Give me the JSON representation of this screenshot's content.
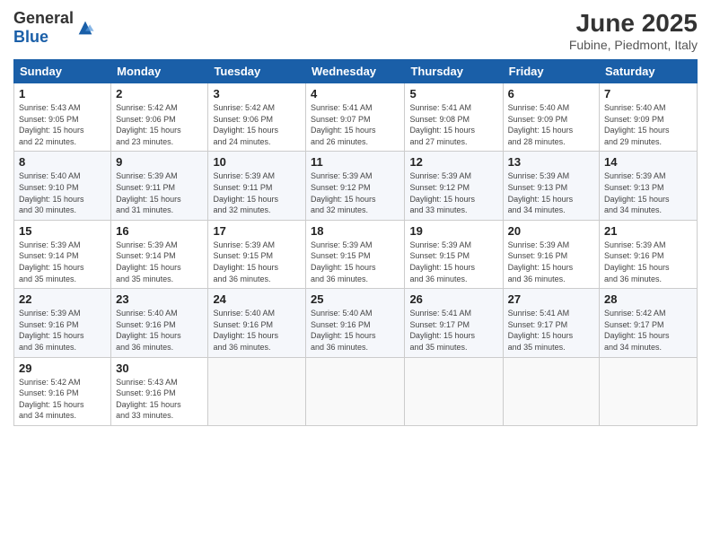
{
  "header": {
    "logo_general": "General",
    "logo_blue": "Blue",
    "month": "June 2025",
    "location": "Fubine, Piedmont, Italy"
  },
  "weekdays": [
    "Sunday",
    "Monday",
    "Tuesday",
    "Wednesday",
    "Thursday",
    "Friday",
    "Saturday"
  ],
  "weeks": [
    [
      {
        "day": "1",
        "info": "Sunrise: 5:43 AM\nSunset: 9:05 PM\nDaylight: 15 hours\nand 22 minutes."
      },
      {
        "day": "2",
        "info": "Sunrise: 5:42 AM\nSunset: 9:06 PM\nDaylight: 15 hours\nand 23 minutes."
      },
      {
        "day": "3",
        "info": "Sunrise: 5:42 AM\nSunset: 9:06 PM\nDaylight: 15 hours\nand 24 minutes."
      },
      {
        "day": "4",
        "info": "Sunrise: 5:41 AM\nSunset: 9:07 PM\nDaylight: 15 hours\nand 26 minutes."
      },
      {
        "day": "5",
        "info": "Sunrise: 5:41 AM\nSunset: 9:08 PM\nDaylight: 15 hours\nand 27 minutes."
      },
      {
        "day": "6",
        "info": "Sunrise: 5:40 AM\nSunset: 9:09 PM\nDaylight: 15 hours\nand 28 minutes."
      },
      {
        "day": "7",
        "info": "Sunrise: 5:40 AM\nSunset: 9:09 PM\nDaylight: 15 hours\nand 29 minutes."
      }
    ],
    [
      {
        "day": "8",
        "info": "Sunrise: 5:40 AM\nSunset: 9:10 PM\nDaylight: 15 hours\nand 30 minutes."
      },
      {
        "day": "9",
        "info": "Sunrise: 5:39 AM\nSunset: 9:11 PM\nDaylight: 15 hours\nand 31 minutes."
      },
      {
        "day": "10",
        "info": "Sunrise: 5:39 AM\nSunset: 9:11 PM\nDaylight: 15 hours\nand 32 minutes."
      },
      {
        "day": "11",
        "info": "Sunrise: 5:39 AM\nSunset: 9:12 PM\nDaylight: 15 hours\nand 32 minutes."
      },
      {
        "day": "12",
        "info": "Sunrise: 5:39 AM\nSunset: 9:12 PM\nDaylight: 15 hours\nand 33 minutes."
      },
      {
        "day": "13",
        "info": "Sunrise: 5:39 AM\nSunset: 9:13 PM\nDaylight: 15 hours\nand 34 minutes."
      },
      {
        "day": "14",
        "info": "Sunrise: 5:39 AM\nSunset: 9:13 PM\nDaylight: 15 hours\nand 34 minutes."
      }
    ],
    [
      {
        "day": "15",
        "info": "Sunrise: 5:39 AM\nSunset: 9:14 PM\nDaylight: 15 hours\nand 35 minutes."
      },
      {
        "day": "16",
        "info": "Sunrise: 5:39 AM\nSunset: 9:14 PM\nDaylight: 15 hours\nand 35 minutes."
      },
      {
        "day": "17",
        "info": "Sunrise: 5:39 AM\nSunset: 9:15 PM\nDaylight: 15 hours\nand 36 minutes."
      },
      {
        "day": "18",
        "info": "Sunrise: 5:39 AM\nSunset: 9:15 PM\nDaylight: 15 hours\nand 36 minutes."
      },
      {
        "day": "19",
        "info": "Sunrise: 5:39 AM\nSunset: 9:15 PM\nDaylight: 15 hours\nand 36 minutes."
      },
      {
        "day": "20",
        "info": "Sunrise: 5:39 AM\nSunset: 9:16 PM\nDaylight: 15 hours\nand 36 minutes."
      },
      {
        "day": "21",
        "info": "Sunrise: 5:39 AM\nSunset: 9:16 PM\nDaylight: 15 hours\nand 36 minutes."
      }
    ],
    [
      {
        "day": "22",
        "info": "Sunrise: 5:39 AM\nSunset: 9:16 PM\nDaylight: 15 hours\nand 36 minutes."
      },
      {
        "day": "23",
        "info": "Sunrise: 5:40 AM\nSunset: 9:16 PM\nDaylight: 15 hours\nand 36 minutes."
      },
      {
        "day": "24",
        "info": "Sunrise: 5:40 AM\nSunset: 9:16 PM\nDaylight: 15 hours\nand 36 minutes."
      },
      {
        "day": "25",
        "info": "Sunrise: 5:40 AM\nSunset: 9:16 PM\nDaylight: 15 hours\nand 36 minutes."
      },
      {
        "day": "26",
        "info": "Sunrise: 5:41 AM\nSunset: 9:17 PM\nDaylight: 15 hours\nand 35 minutes."
      },
      {
        "day": "27",
        "info": "Sunrise: 5:41 AM\nSunset: 9:17 PM\nDaylight: 15 hours\nand 35 minutes."
      },
      {
        "day": "28",
        "info": "Sunrise: 5:42 AM\nSunset: 9:17 PM\nDaylight: 15 hours\nand 34 minutes."
      }
    ],
    [
      {
        "day": "29",
        "info": "Sunrise: 5:42 AM\nSunset: 9:16 PM\nDaylight: 15 hours\nand 34 minutes."
      },
      {
        "day": "30",
        "info": "Sunrise: 5:43 AM\nSunset: 9:16 PM\nDaylight: 15 hours\nand 33 minutes."
      },
      {
        "day": "",
        "info": ""
      },
      {
        "day": "",
        "info": ""
      },
      {
        "day": "",
        "info": ""
      },
      {
        "day": "",
        "info": ""
      },
      {
        "day": "",
        "info": ""
      }
    ]
  ]
}
